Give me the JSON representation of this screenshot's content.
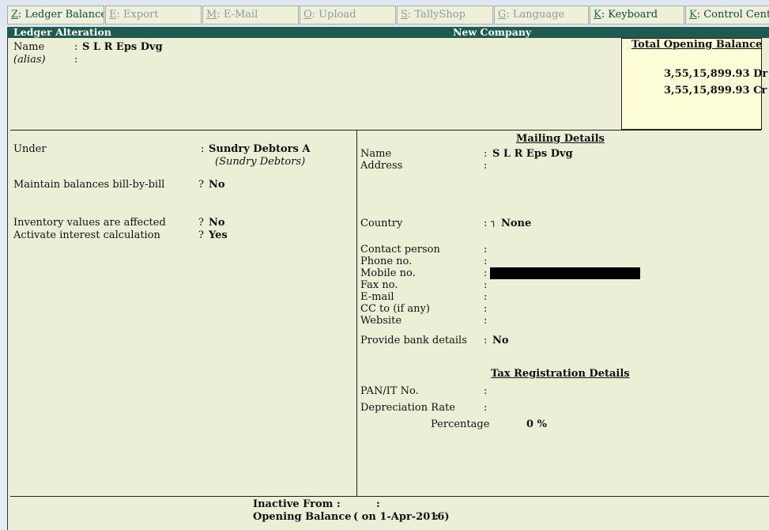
{
  "toolbar": {
    "buttons": [
      {
        "key": "Z",
        "label": ": Ledger Balance"
      },
      {
        "key": "E",
        "label": ": Export"
      },
      {
        "key": "M",
        "label": ": E-Mail"
      },
      {
        "key": "O",
        "label": ": Upload"
      },
      {
        "key": "S",
        "label": ": TallyShop"
      },
      {
        "key": "G",
        "label": ": Language"
      },
      {
        "key": "K",
        "label": ": Keyboard"
      },
      {
        "key": "K",
        "label": ": Control Centre"
      }
    ]
  },
  "header": {
    "screen_title": "Ledger Alteration",
    "company": "New Company"
  },
  "ledger": {
    "name_label": "Name",
    "name_value": "S L R Eps Dvg",
    "alias_label": "(alias)",
    "sep": ":"
  },
  "opening_total": {
    "title": "Total Opening Balance",
    "dr": "3,55,15,899.93 Dr",
    "cr": "3,55,15,899.93 Cr"
  },
  "left": {
    "under_label": "Under",
    "under_value": "Sundry Debtors A",
    "under_parent": "(Sundry Debtors)",
    "bill_label": "Maintain balances bill-by-bill",
    "bill_value": "No",
    "inventory_label": "Inventory values are affected",
    "inventory_value": "No",
    "interest_label": "Activate interest calculation",
    "interest_value": "Yes",
    "q": "?"
  },
  "mailing": {
    "title": "Mailing Details",
    "name_label": "Name",
    "name_value": "S L R Eps Dvg",
    "address_label": "Address",
    "country_label": "Country",
    "country_value": "None",
    "country_glyph": "┐",
    "contact_label": "Contact person",
    "phone_label": "Phone no.",
    "mobile_label": "Mobile no.",
    "fax_label": "Fax no.",
    "email_label": "E-mail",
    "cc_label": "CC to (if any)",
    "website_label": "Website",
    "bank_label": "Provide bank details",
    "bank_value": "No"
  },
  "tax": {
    "title": "Tax Registration Details",
    "pan_label": "PAN/IT No.",
    "dep_label": "Depreciation Rate",
    "pct_label": "Percentage",
    "pct_value": "0 %"
  },
  "footer": {
    "inactive_label": "Inactive From :",
    "inactive_sep": ":",
    "opening_label": "Opening Balance",
    "opening_date": "( on 1-Apr-2016)",
    "opening_sep": ":"
  },
  "colors": {
    "title_bar": "#1e5a4d",
    "background": "#edeed6",
    "highlight_box": "#fdfdd8"
  }
}
